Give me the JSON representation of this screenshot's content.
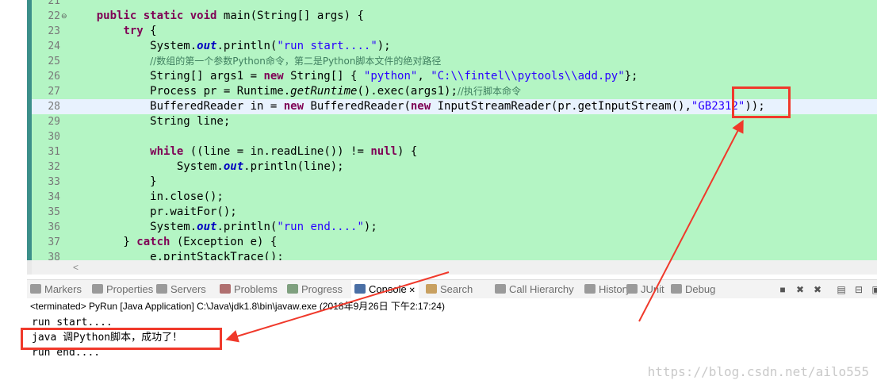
{
  "editor": {
    "lines": [
      {
        "num": "21",
        "code": ""
      },
      {
        "num": "22",
        "fold": "⊖",
        "parts": [
          [
            "    ",
            ""
          ],
          [
            "public",
            "kw"
          ],
          [
            " ",
            ""
          ],
          [
            "static",
            "kw"
          ],
          [
            " ",
            ""
          ],
          [
            "void",
            "kw"
          ],
          [
            " main(String[] args) {",
            ""
          ]
        ]
      },
      {
        "num": "23",
        "parts": [
          [
            "        ",
            ""
          ],
          [
            "try",
            "kw"
          ],
          [
            " {",
            ""
          ]
        ]
      },
      {
        "num": "24",
        "parts": [
          [
            "            System.",
            ""
          ],
          [
            "out",
            "fld"
          ],
          [
            ".println(",
            ""
          ],
          [
            "\"run start....\"",
            "str"
          ],
          [
            ");",
            ""
          ]
        ]
      },
      {
        "num": "25",
        "parts": [
          [
            "            ",
            ""
          ],
          [
            "//数组的第一个参数Python命令，第二是Python脚本文件的绝对路径",
            "cmt"
          ]
        ]
      },
      {
        "num": "26",
        "parts": [
          [
            "            String[] args1 = ",
            ""
          ],
          [
            "new",
            "kw"
          ],
          [
            " String[] { ",
            ""
          ],
          [
            "\"python\"",
            "str"
          ],
          [
            ", ",
            ""
          ],
          [
            "\"C:\\\\fintel\\\\pytools\\\\add.py\"",
            "str"
          ],
          [
            "};",
            ""
          ]
        ]
      },
      {
        "num": "27",
        "parts": [
          [
            "            Process pr = Runtime.",
            ""
          ],
          [
            "getRuntime",
            "ital"
          ],
          [
            "().exec(args1);",
            ""
          ],
          [
            "//执行脚本命令",
            "cmt"
          ]
        ]
      },
      {
        "num": "28",
        "hl": true,
        "parts": [
          [
            "            BufferedReader in = ",
            ""
          ],
          [
            "new",
            "kw"
          ],
          [
            " BufferedReader(",
            ""
          ],
          [
            "new",
            "kw"
          ],
          [
            " InputStreamReader(pr.getInputStream(),",
            ""
          ],
          [
            "\"GB2312\"",
            "str"
          ],
          [
            "));",
            ""
          ]
        ]
      },
      {
        "num": "29",
        "parts": [
          [
            "            String line;",
            ""
          ]
        ]
      },
      {
        "num": "30",
        "parts": [
          [
            "",
            ""
          ]
        ]
      },
      {
        "num": "31",
        "parts": [
          [
            "            ",
            ""
          ],
          [
            "while",
            "kw"
          ],
          [
            " ((line = in.readLine()) != ",
            ""
          ],
          [
            "null",
            "kw"
          ],
          [
            ") {",
            ""
          ]
        ]
      },
      {
        "num": "32",
        "parts": [
          [
            "                System.",
            ""
          ],
          [
            "out",
            "fld"
          ],
          [
            ".println(line);",
            ""
          ]
        ]
      },
      {
        "num": "33",
        "parts": [
          [
            "            }",
            ""
          ]
        ]
      },
      {
        "num": "34",
        "parts": [
          [
            "            in.close();",
            ""
          ]
        ]
      },
      {
        "num": "35",
        "parts": [
          [
            "            pr.waitFor();",
            ""
          ]
        ]
      },
      {
        "num": "36",
        "parts": [
          [
            "            System.",
            ""
          ],
          [
            "out",
            "fld"
          ],
          [
            ".println(",
            ""
          ],
          [
            "\"run end....\"",
            "str"
          ],
          [
            ");",
            ""
          ]
        ]
      },
      {
        "num": "37",
        "parts": [
          [
            "        } ",
            ""
          ],
          [
            "catch",
            "kw"
          ],
          [
            " (Exception e) {",
            ""
          ]
        ]
      },
      {
        "num": "38",
        "parts": [
          [
            "            e.printStackTrace();",
            ""
          ]
        ]
      }
    ]
  },
  "tabs": [
    {
      "label": "Markers",
      "icon": "markers-icon",
      "color": "#9a9a9a"
    },
    {
      "label": "Properties",
      "icon": "properties-icon",
      "color": "#9a9a9a"
    },
    {
      "label": "Servers",
      "icon": "servers-icon",
      "color": "#9a9a9a"
    },
    {
      "label": "Problems",
      "icon": "problems-icon",
      "color": "#b07070"
    },
    {
      "label": "Progress",
      "icon": "progress-icon",
      "color": "#7fa07f"
    },
    {
      "label": "Console",
      "icon": "console-icon",
      "color": "#4a6fa5",
      "active": true
    },
    {
      "label": "Search",
      "icon": "search-icon",
      "color": "#c8a060"
    },
    {
      "label": "Call Hierarchy",
      "icon": "call-hierarchy-icon",
      "color": "#9a9a9a"
    },
    {
      "label": "History",
      "icon": "history-icon",
      "color": "#9a9a9a"
    },
    {
      "label": "JUnit",
      "icon": "junit-icon",
      "color": "#9a9a9a"
    },
    {
      "label": "Debug",
      "icon": "debug-icon",
      "color": "#9a9a9a"
    }
  ],
  "toolbar_icons": [
    "terminate-icon",
    "remove-launch-icon",
    "remove-all-icon",
    "scroll-lock-icon",
    "pin-console-icon",
    "display-console-icon"
  ],
  "console": {
    "status": "<terminated> PyRun [Java Application] C:\\Java\\jdk1.8\\bin\\javaw.exe (2018年9月26日 下午2:17:24)",
    "output": [
      "run start....",
      "java 调Python脚本，成功了！",
      "run end...."
    ]
  },
  "annotations": {
    "color": "#f0392b"
  },
  "watermark": "https://blog.csdn.net/ailo555"
}
